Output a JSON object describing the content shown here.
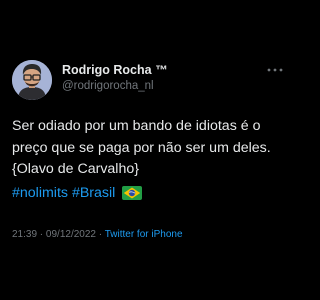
{
  "author": {
    "display_name": "Rodrigo Rocha",
    "badge": "™",
    "handle": "@rodrigorocha_nl",
    "avatar_icon": "avatar-icon"
  },
  "tweet": {
    "text": "Ser odiado por um bando de idiotas é o preço que se paga por não ser um deles. {Olavo de Carvalho}",
    "hashtags": [
      "#nolimits",
      "#Brasil"
    ],
    "flag_icon": "brazil-flag-icon"
  },
  "meta": {
    "time": "21:39",
    "separator": " · ",
    "date": "09/12/2022",
    "source": "Twitter for iPhone"
  },
  "colors": {
    "background": "#000000",
    "text": "#e7e9ea",
    "muted": "#71767b",
    "link": "#1d9bf0"
  }
}
